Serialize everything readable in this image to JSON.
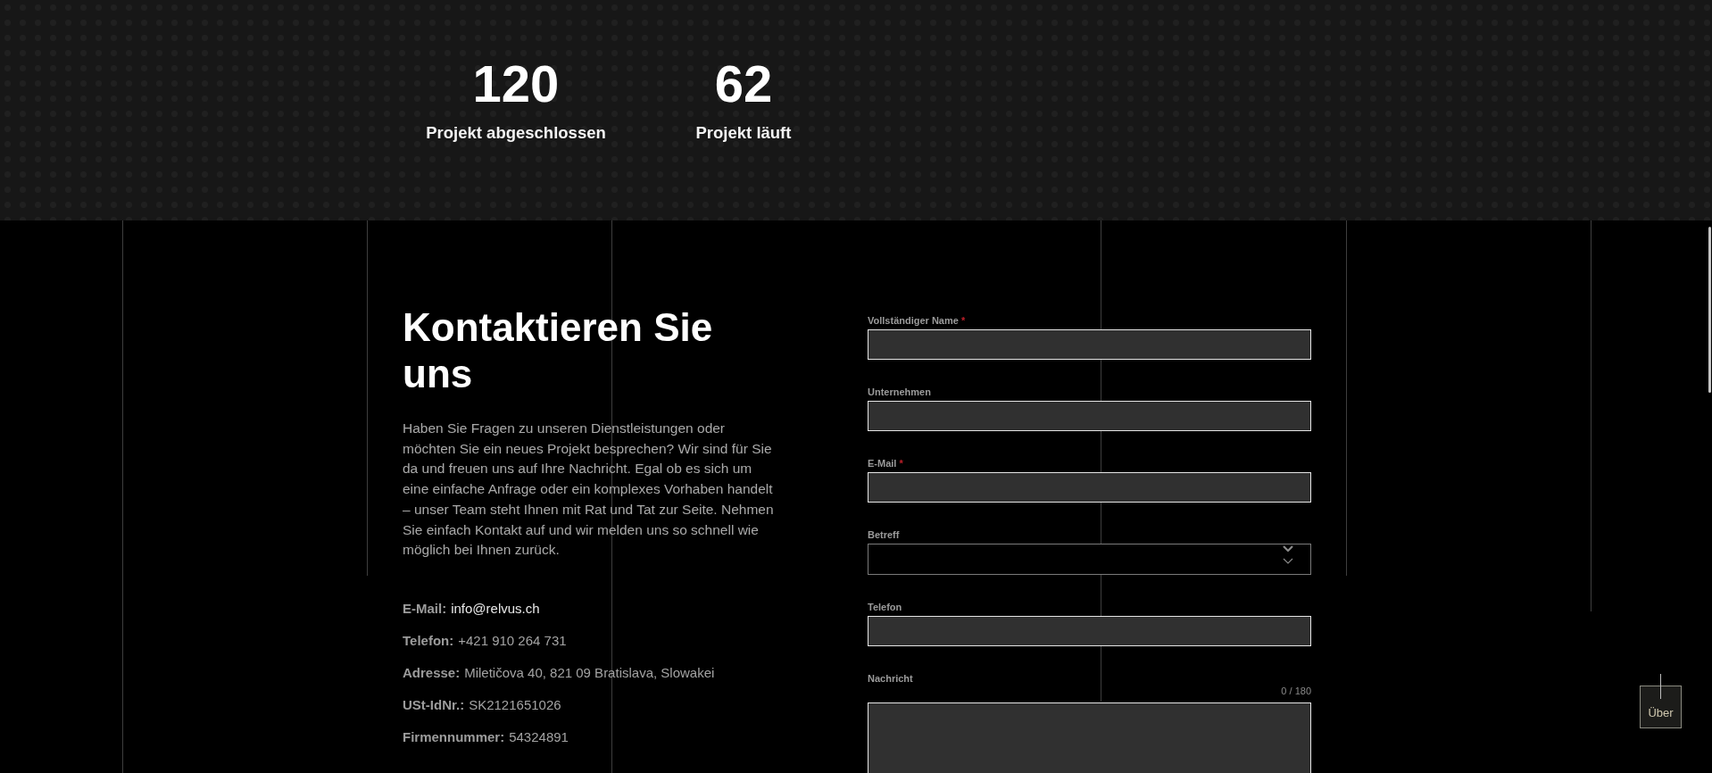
{
  "stats": [
    {
      "value": "120",
      "label": "Projekt abgeschlossen"
    },
    {
      "value": "62",
      "label": "Projekt läuft"
    }
  ],
  "contact": {
    "title": "Kontaktieren Sie uns",
    "intro": "Haben Sie Fragen zu unseren Dienstleistungen oder möchten Sie ein neues Projekt besprechen? Wir sind für Sie da und freuen uns auf Ihre Nachricht. Egal ob es sich um eine einfache Anfrage oder ein komplexes Vorhaben handelt – unser Team steht Ihnen mit Rat und Tat zur Seite. Nehmen Sie einfach Kontakt auf und wir melden uns so schnell wie möglich bei Ihnen zurück.",
    "details": [
      {
        "kind": "link",
        "label": "E-Mail:",
        "value": "info@relvus.ch"
      },
      {
        "kind": "text",
        "label": "Telefon:",
        "value": "+421 910 264 731"
      },
      {
        "kind": "text",
        "label": "Adresse:",
        "value": "Miletičova 40, 821 09 Bratislava, Slowakei"
      },
      {
        "kind": "text",
        "label": "USt-IdNr.:",
        "value": "SK2121651026"
      },
      {
        "kind": "text",
        "label": "Firmennummer:",
        "value": "54324891"
      }
    ]
  },
  "form": {
    "required_mark": "*",
    "fields": [
      {
        "kind": "text",
        "label": "Vollständiger Name",
        "required": true
      },
      {
        "kind": "text",
        "label": "Unternehmen",
        "required": false
      },
      {
        "kind": "text",
        "label": "E-Mail",
        "required": true
      },
      {
        "kind": "select",
        "label": "Betreff",
        "required": false
      },
      {
        "kind": "text",
        "label": "Telefon",
        "required": false
      },
      {
        "kind": "textarea",
        "label": "Nachricht",
        "required": false,
        "counter": "0 / 180"
      }
    ]
  },
  "side_button": {
    "label": "Über"
  }
}
